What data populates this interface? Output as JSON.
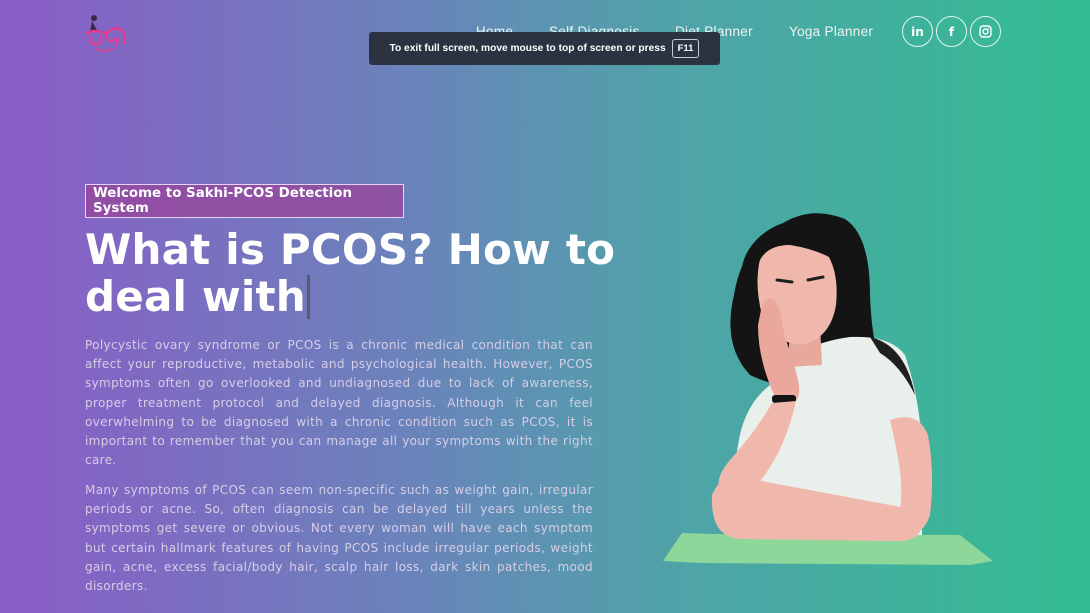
{
  "nav": {
    "items": [
      {
        "label": "Home"
      },
      {
        "label": "Self Diagnosis"
      },
      {
        "label": "Diet Planner"
      },
      {
        "label": "Yoga Planner"
      }
    ]
  },
  "social": {
    "linkedin": "in",
    "facebook": "f"
  },
  "toast": {
    "text": "To exit full screen, move mouse to top of screen or press",
    "key": "F11"
  },
  "hero": {
    "badge": "Welcome to Sakhi-PCOS Detection System",
    "title_line1": "What is PCOS? How to",
    "title_line2": "deal with",
    "paragraph1": "Polycystic ovary syndrome or PCOS is a chronic medical condition that can affect your reproductive, metabolic and psychological health. However, PCOS symptoms often go overlooked and undiagnosed due to lack of awareness, proper treatment protocol and delayed diagnosis. Although it can feel overwhelming to be diagnosed with a chronic condition such as PCOS, it is important to remember that you can manage all your symptoms with the right care.",
    "paragraph2": "Many symptoms of PCOS can seem non-specific such as weight gain, irregular periods or acne. So, often diagnosis can be delayed till years unless the symptoms get severe or obvious. Not every woman will have each symptom but certain hallmark features of having PCOS include irregular periods, weight gain, acne, excess facial/body hair, scalp hair loss, dark skin patches, mood disorders."
  },
  "colors": {
    "gradient_start": "#8a5cc6",
    "gradient_end": "#33bd92",
    "badge_bg": "#96489e",
    "toast_bg": "#2b3340"
  },
  "icons": [
    "logo-icon",
    "linkedin-icon",
    "facebook-icon",
    "instagram-icon",
    "woman-illustration"
  ]
}
